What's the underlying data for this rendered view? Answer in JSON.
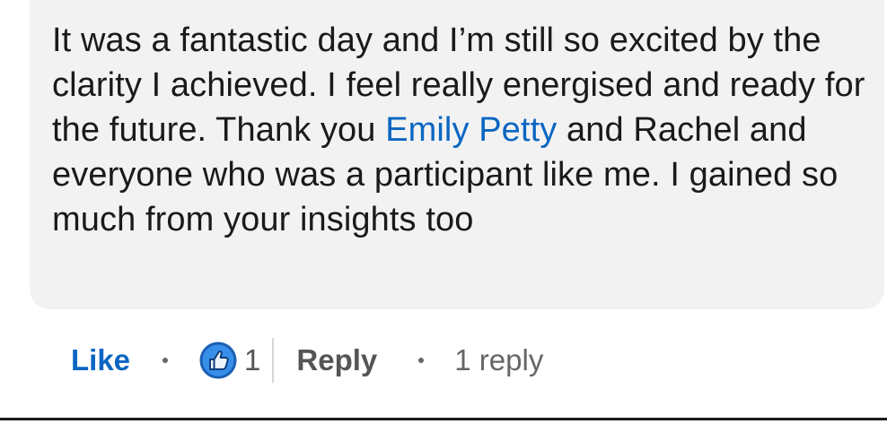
{
  "comment": {
    "text_part1": "It was a fantastic day and I’m still so excited by the clarity I achieved. I feel really energised and ready for the future. Thank you ",
    "mention": "Emily Petty",
    "text_part2": "  and Rachel and everyone who was a participant like me. I gained so much from your insights too"
  },
  "actions": {
    "like_label": "Like",
    "reaction_icon": "thumbs-up-icon",
    "reaction_count": "1",
    "reply_label": "Reply",
    "reply_count_label": "1 reply"
  },
  "colors": {
    "accent": "#0a66c2",
    "bubble": "#f2f2f2",
    "text": "#1a1a1a",
    "muted": "#666666"
  }
}
